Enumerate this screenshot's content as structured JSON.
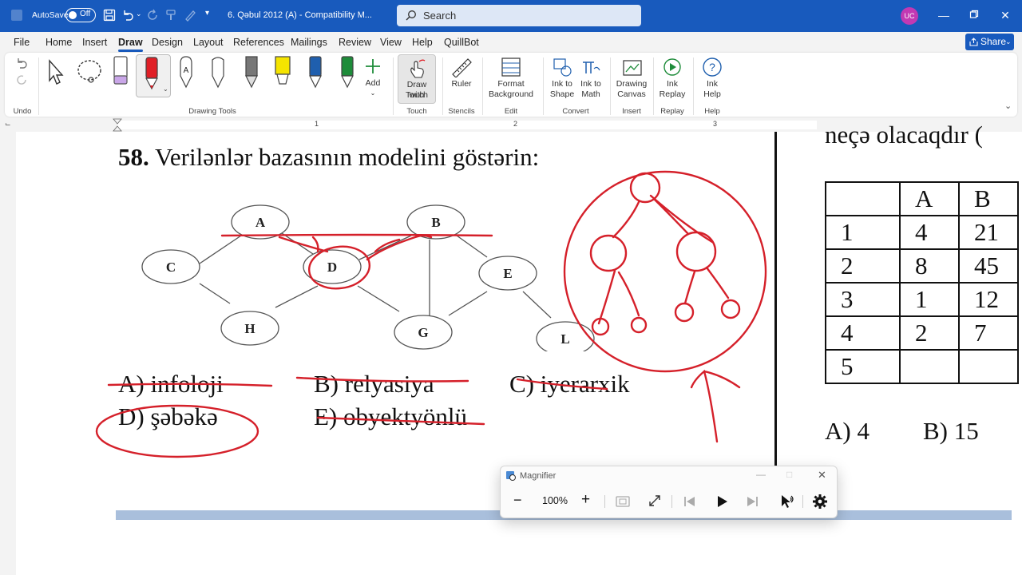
{
  "titlebar": {
    "autosave_label": "AutoSave",
    "autosave_state": "Off",
    "document_title": "6. Qəbul 2012 (A)  -  Compatibility M...",
    "search_placeholder": "Search",
    "user_initials": "UC"
  },
  "menu": {
    "tabs": [
      "File",
      "Home",
      "Insert",
      "Draw",
      "Design",
      "Layout",
      "References",
      "Mailings",
      "Review",
      "View",
      "Help",
      "QuillBot"
    ],
    "active_tab": "Draw",
    "share_label": "Share"
  },
  "ribbon": {
    "groups": {
      "undo": "Undo",
      "drawing_tools": "Drawing Tools",
      "touch": "Touch",
      "stencils": "Stencils",
      "edit": "Edit",
      "convert": "Convert",
      "insert": "Insert",
      "replay": "Replay",
      "help": "Help"
    },
    "buttons": {
      "add": "Add",
      "draw_with_touch_1": "Draw with",
      "draw_with_touch_2": "Touch",
      "ruler": "Ruler",
      "format_bg_1": "Format",
      "format_bg_2": "Background",
      "ink_to_shape_1": "Ink to",
      "ink_to_shape_2": "Shape",
      "ink_to_math_1": "Ink to",
      "ink_to_math_2": "Math",
      "drawing_canvas_1": "Drawing",
      "drawing_canvas_2": "Canvas",
      "ink_replay_1": "Ink",
      "ink_replay_2": "Replay",
      "ink_help_1": "Ink",
      "ink_help_2": "Help"
    },
    "pen_colors": [
      "#8a8a8a",
      "#e8e8e8",
      "#b19cd9",
      "#e01f26",
      "#2b2b2b",
      "#e0e0e0",
      "#777777",
      "#f5e400",
      "#1f5fae",
      "#1e8c3a"
    ]
  },
  "ruler": {
    "numbers": [
      "1",
      "2",
      "3"
    ]
  },
  "document": {
    "question_number": "58.",
    "question_text": "Verilənlər bazasının modelini göstərin:",
    "nodes": [
      "A",
      "B",
      "C",
      "D",
      "E",
      "H",
      "G",
      "L"
    ],
    "answers": {
      "a": "A) infoloji",
      "b": "B) relyasiya",
      "c": "C) iyerarxik",
      "d": "D) şəbəkə",
      "e": "E) obyektyönlü"
    },
    "right_top_text": "neçə olacaqdır (",
    "right_answers": {
      "a": "A) 4",
      "b": "B) 15"
    },
    "table": {
      "header": [
        "",
        "A",
        "B"
      ],
      "rows": [
        [
          "1",
          "4",
          "21"
        ],
        [
          "2",
          "8",
          "45"
        ],
        [
          "3",
          "1",
          "12"
        ],
        [
          "4",
          "2",
          "7"
        ],
        [
          "5",
          "",
          ""
        ]
      ]
    },
    "ink_color": "#d5202a"
  },
  "magnifier": {
    "title": "Magnifier",
    "zoom": "100%"
  }
}
